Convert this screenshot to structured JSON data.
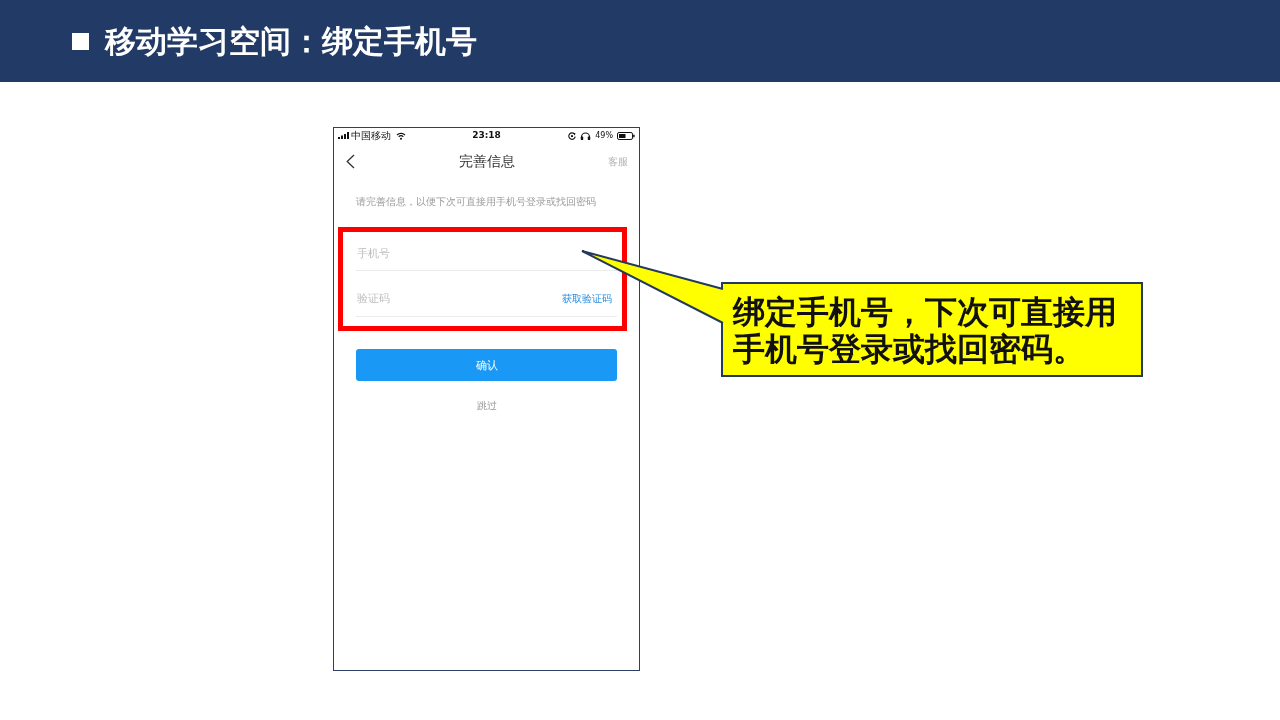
{
  "slide": {
    "title": "移动学习空间：绑定手机号"
  },
  "phone": {
    "status_bar": {
      "carrier": "中国移动",
      "time": "23:18",
      "battery": "49%"
    },
    "nav": {
      "title": "完善信息",
      "action": "客服"
    },
    "hint": "请完善信息，以便下次可直接用手机号登录或找回密码",
    "fields": [
      {
        "placeholder": "手机号"
      },
      {
        "placeholder": "验证码",
        "action": "获取验证码"
      }
    ],
    "confirm_button": "确认",
    "skip_link": "跳过"
  },
  "callout": {
    "text": "绑定手机号，下次可直接用手机号登录或找回密码。"
  }
}
